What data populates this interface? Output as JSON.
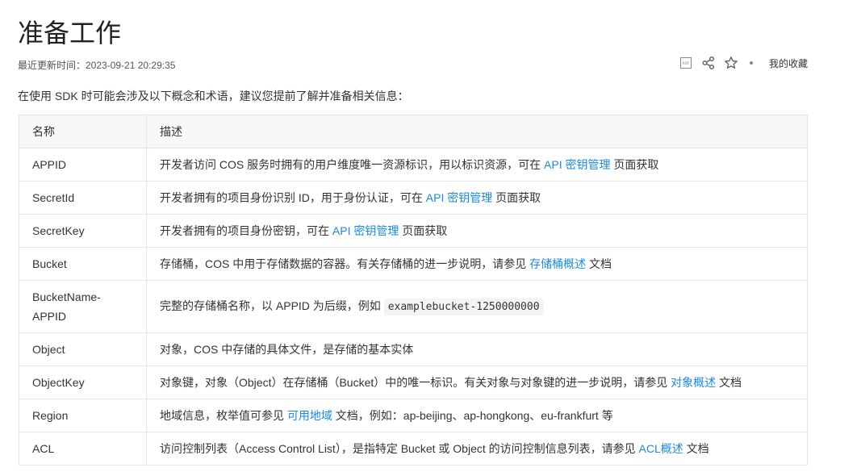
{
  "doc": {
    "title": "准备工作",
    "updated": "最近更新时间：2023-09-21 20:29:35",
    "favorites": "我的收藏",
    "intro": "在使用 SDK 时可能会涉及以下概念和术语，建议您提前了解并准备相关信息："
  },
  "table": {
    "headers": [
      "名称",
      "描述"
    ],
    "rows": {
      "appid": {
        "name": "APPID",
        "pre": "开发者访问 COS 服务时拥有的用户维度唯一资源标识，用以标识资源，可在",
        "link": "API 密钥管理",
        "post": "页面获取"
      },
      "secretid": {
        "name": "SecretId",
        "pre": "开发者拥有的项目身份识别 ID，用于身份认证，可在",
        "link": "API 密钥管理",
        "post": "页面获取"
      },
      "secretkey": {
        "name": "SecretKey",
        "pre": "开发者拥有的项目身份密钥，可在",
        "link": "API 密钥管理",
        "post": "页面获取"
      },
      "bucket": {
        "name": "Bucket",
        "pre": "存储桶，COS 中用于存储数据的容器。有关存储桶的进一步说明，请参见",
        "link": "存储桶概述",
        "post": "文档"
      },
      "bucketname": {
        "name": "BucketName-APPID",
        "pre": "完整的存储桶名称，以 APPID 为后缀，例如",
        "code": "examplebucket-1250000000"
      },
      "object": {
        "name": "Object",
        "pre": "对象，COS 中存储的具体文件，是存储的基本实体"
      },
      "objectkey": {
        "name": "ObjectKey",
        "pre": "对象键，对象（Object）在存储桶（Bucket）中的唯一标识。有关对象与对象键的进一步说明，请参见",
        "link": "对象概述",
        "post": "文档"
      },
      "region": {
        "name": "Region",
        "pre": "地域信息，枚举值可参见",
        "link": "可用地域",
        "post": "文档，例如：ap-beijing、ap-hongkong、eu-frankfurt 等"
      },
      "acl": {
        "name": "ACL",
        "pre": "访问控制列表（Access Control List），是指特定 Bucket 或 Object 的访问控制信息列表，请参见",
        "link": "ACL概述",
        "post": "文档"
      }
    }
  },
  "icons": {
    "pdf": "pdf-icon",
    "share": "share-icon",
    "star": "star-icon",
    "color_link": "#1a8ae6"
  }
}
